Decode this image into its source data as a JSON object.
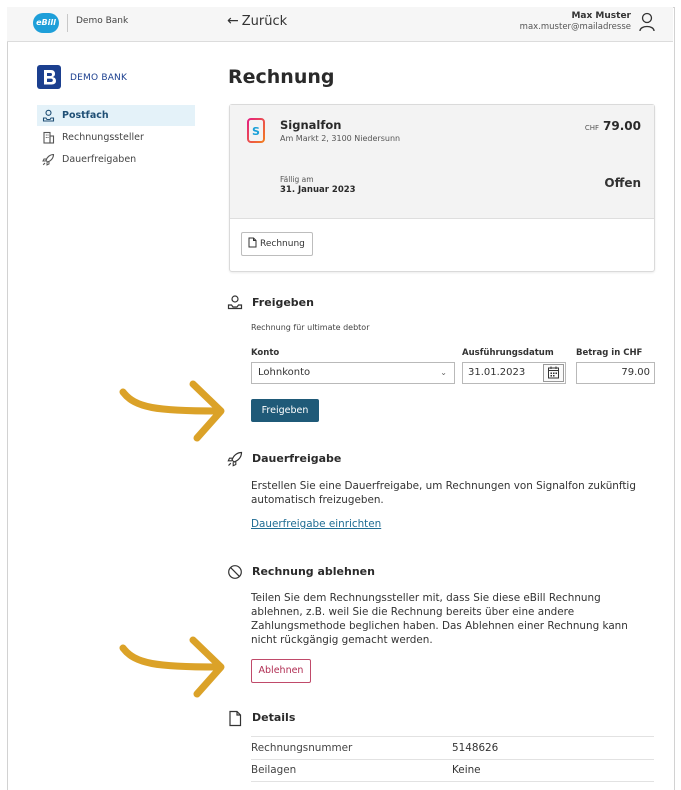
{
  "colors": {
    "accent": "#1f5a78",
    "ebill_logo": "#1e9fd9",
    "brand": "#1b3f8f",
    "danger": "#b02d52",
    "annotation_arrow": "#dba228"
  },
  "header": {
    "logo_text": "eBill",
    "bank_name": "Demo Bank",
    "back_label": "Zurück",
    "back_icon": "arrow-left-icon",
    "user_name": "Max Muster",
    "user_email": "max.muster@mailadresse",
    "user_icon": "person-icon"
  },
  "sidebar": {
    "brand_text": "DEMO BANK",
    "items": [
      {
        "label": "Postfach",
        "icon": "inbox-people-icon",
        "active": true
      },
      {
        "label": "Rechnungssteller",
        "icon": "building-icon",
        "active": false
      },
      {
        "label": "Dauerfreigaben",
        "icon": "rocket-icon",
        "active": false
      }
    ]
  },
  "main": {
    "title": "Rechnung",
    "invoice": {
      "payee": "Signalfon",
      "address": "Am Markt 2, 3100 Niedersunn",
      "currency": "CHF",
      "amount": "79.00",
      "due_label": "Fällig am",
      "due_date": "31. Januar 2023",
      "status": "Offen",
      "pdf_button": "Rechnung"
    },
    "freigeben": {
      "heading": "Freigeben",
      "subtitle": "Rechnung für ultimate debtor",
      "konto_label": "Konto",
      "konto_value": "Lohnkonto",
      "date_label": "Ausführungsdatum",
      "date_value": "31.01.2023",
      "amount_label": "Betrag in CHF",
      "amount_value": "79.00",
      "button": "Freigeben"
    },
    "dauerfreigabe": {
      "heading": "Dauerfreigabe",
      "text_line1": "Erstellen Sie eine Dauerfreigabe, um Rechnungen von Signalfon zukünftig",
      "text_line2": "automatisch freizugeben.",
      "link": "Dauerfreigabe einrichten"
    },
    "ablehnen": {
      "heading": "Rechnung ablehnen",
      "text_lines": [
        "Teilen Sie dem Rechnungssteller mit, dass Sie diese eBill Rechnung",
        "ablehnen, z.B. weil Sie die Rechnung bereits über eine andere",
        "Zahlungsmethode beglichen haben. Das Ablehnen einer Rechnung kann",
        "nicht rückgängig gemacht werden."
      ],
      "button": "Ablehnen"
    },
    "details": {
      "heading": "Details",
      "rows": [
        {
          "key": "Rechnungsnummer",
          "value": "5148626"
        },
        {
          "key": "Beilagen",
          "value": "Keine"
        }
      ]
    }
  }
}
